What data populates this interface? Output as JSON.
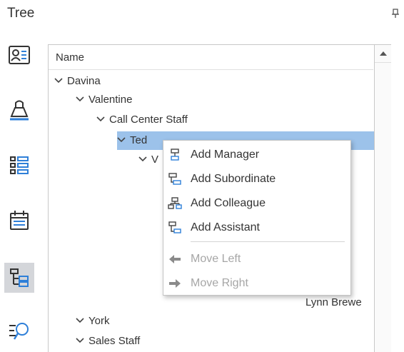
{
  "panel": {
    "title": "Tree"
  },
  "sidebar": {
    "items": [
      {
        "icon": "contact-card-icon"
      },
      {
        "icon": "bucket-icon"
      },
      {
        "icon": "list-icon"
      },
      {
        "icon": "calendar-list-icon"
      },
      {
        "icon": "org-tree-icon",
        "active": true
      },
      {
        "icon": "search-list-icon"
      }
    ]
  },
  "tree": {
    "header": "Name",
    "rows": [
      {
        "label": "Davina",
        "expanded": true
      },
      {
        "label": "Valentine",
        "expanded": true
      },
      {
        "label": "Call Center Staff",
        "expanded": true
      },
      {
        "label": "Ted",
        "expanded": true,
        "selected": true
      },
      {
        "label": "V",
        "expanded": true
      },
      {
        "label": "Lynn Brewe"
      },
      {
        "label": "York",
        "expanded": true
      },
      {
        "label": "Sales Staff",
        "expanded": true
      }
    ]
  },
  "context_menu": {
    "items": [
      {
        "label": "Add Manager",
        "icon": "add-manager-icon",
        "enabled": true
      },
      {
        "label": "Add Subordinate",
        "icon": "add-subordinate-icon",
        "enabled": true
      },
      {
        "label": "Add Colleague",
        "icon": "add-colleague-icon",
        "enabled": true
      },
      {
        "label": "Add Assistant",
        "icon": "add-assistant-icon",
        "enabled": true
      },
      {
        "label": "Move Left",
        "icon": "arrow-left-icon",
        "enabled": false
      },
      {
        "label": "Move Right",
        "icon": "arrow-right-icon",
        "enabled": false
      }
    ]
  },
  "colors": {
    "accent": "#2e7fd8",
    "selection": "#9cc2ea",
    "disabled": "#a6a6a6"
  }
}
